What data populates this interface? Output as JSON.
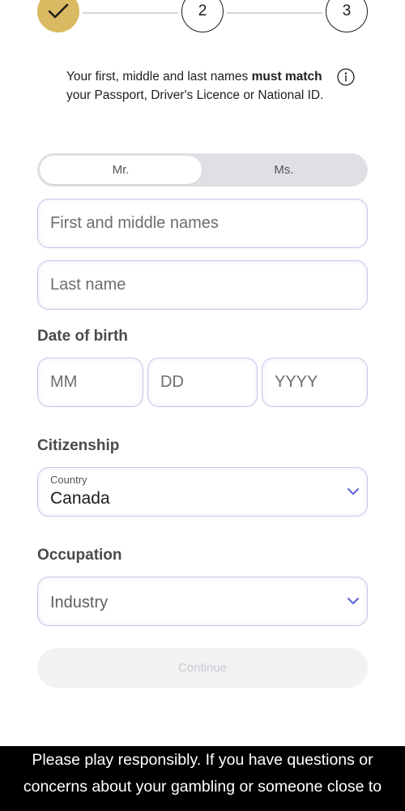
{
  "stepper": {
    "step2": "2",
    "step3": "3"
  },
  "notice": {
    "part1": "Your first, middle and last names ",
    "bold1": "must match",
    "part2": " your Passport, Driver's Licence or National ID."
  },
  "title_toggle": {
    "mr": "Mr.",
    "ms": "Ms."
  },
  "names": {
    "first_placeholder": "First and middle names",
    "last_placeholder": "Last name"
  },
  "dob": {
    "label": "Date of birth",
    "mm": "MM",
    "dd": "DD",
    "yyyy": "YYYY"
  },
  "citizenship": {
    "label": "Citizenship",
    "field_label": "Country",
    "value": "Canada"
  },
  "occupation": {
    "label": "Occupation",
    "placeholder": "Industry"
  },
  "continue_label": "Continue",
  "banner_text": "Please play responsibly. If you have questions or concerns about your gambling or someone close to",
  "colors": {
    "accent_gold": "#d9b961",
    "field_border": "#c4c5e8",
    "chevron": "#5a63d8"
  }
}
